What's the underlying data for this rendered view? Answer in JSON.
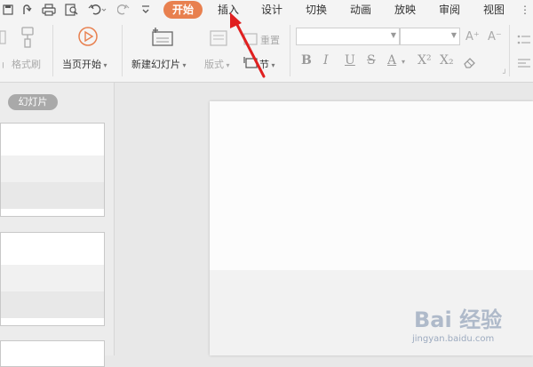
{
  "menu": {
    "tabs": [
      "开始",
      "插入",
      "设计",
      "切换",
      "动画",
      "放映",
      "审阅",
      "视图"
    ],
    "active_tab": "开始"
  },
  "quick_access": {
    "icons": [
      "save-icon",
      "redo-icon",
      "print-icon",
      "print-preview-icon",
      "undo-icon",
      "redo-icon",
      "customize-icon"
    ]
  },
  "ribbon": {
    "format_painter": "格式刷",
    "play_from_current": "当页开始",
    "new_slide": "新建幻灯片",
    "layout": "版式",
    "reset": "重置",
    "section": "节",
    "font_sizes": [
      "A⁺",
      "A⁻"
    ],
    "format_buttons": [
      "B",
      "I",
      "U",
      "S",
      "A",
      "X²",
      "X₂"
    ]
  },
  "panel": {
    "tab_label": "幻灯片"
  },
  "watermark": {
    "brand": "Bai 经验",
    "url": "jingyan.baidu.com"
  },
  "colors": {
    "active_tab": "#e8804f",
    "arrow": "#e02020",
    "play_icon": "#e8804f"
  }
}
